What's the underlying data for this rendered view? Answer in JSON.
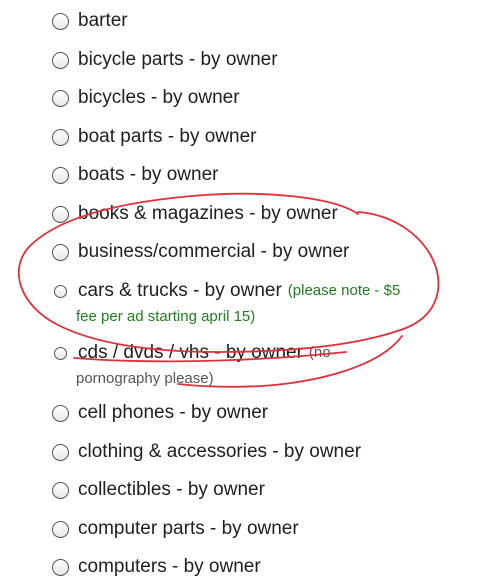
{
  "categories": [
    {
      "label": "barter"
    },
    {
      "label": "bicycle parts - by owner"
    },
    {
      "label": "bicycles - by owner"
    },
    {
      "label": "boat parts - by owner"
    },
    {
      "label": "boats - by owner"
    },
    {
      "label": "books & magazines - by owner"
    },
    {
      "label": "business/commercial - by owner"
    },
    {
      "label": "cars & trucks - by owner",
      "note_1": "(please note - $5",
      "note_2": "fee per ad starting april 15)"
    },
    {
      "label": "cds / dvds / vhs - by owner",
      "note_1": "(no",
      "note_2": "pornography please)"
    },
    {
      "label": "cell phones - by owner"
    },
    {
      "label": "clothing & accessories - by owner"
    },
    {
      "label": "collectibles - by owner"
    },
    {
      "label": "computer parts - by owner"
    },
    {
      "label": "computers - by owner"
    }
  ],
  "colors": {
    "note_green": "#1f7f1f",
    "note_gray": "#555555",
    "annotation_red": "#e0303a"
  }
}
